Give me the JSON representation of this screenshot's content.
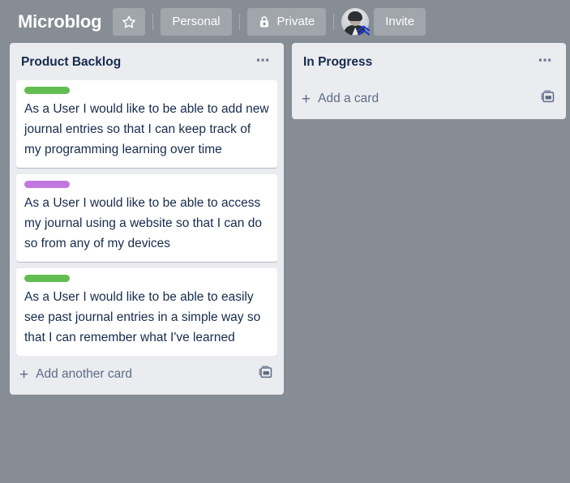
{
  "header": {
    "board_title": "Microblog",
    "star_icon": "star-icon",
    "visibility_button": "Personal",
    "privacy_button": "Private",
    "privacy_icon": "lock-icon",
    "invite_button": "Invite",
    "avatar": "user-avatar",
    "avatar_badge": "chevron-badge-icon"
  },
  "colors": {
    "board_background": "#868d95",
    "list_background": "#ebecf0",
    "card_background": "#ffffff",
    "text_primary": "#172b4d",
    "text_muted": "#5e6c84",
    "label_green": "#61bd4f",
    "label_purple": "#c377e0"
  },
  "lists": [
    {
      "title": "Product Backlog",
      "menu_icon": "ellipsis-icon",
      "cards": [
        {
          "labels": [
            "#61bd4f"
          ],
          "text": "As a User I would like to be able to add new journal entries so that I can keep track of my programming learning over time"
        },
        {
          "labels": [
            "#c377e0"
          ],
          "text": "As a User I would like to be able to access my journal using a website so that I can do so from any of my devices"
        },
        {
          "labels": [
            "#61bd4f"
          ],
          "text": "As a User I would like to be able to easily see past journal entries in a simple way so that I can remember what I've learned"
        }
      ],
      "footer": {
        "add_label": "Add another card",
        "plus_icon": "plus-icon",
        "template_icon": "card-template-icon"
      }
    },
    {
      "title": "In Progress",
      "menu_icon": "ellipsis-icon",
      "cards": [],
      "footer": {
        "add_label": "Add a card",
        "plus_icon": "plus-icon",
        "template_icon": "card-template-icon"
      }
    }
  ]
}
